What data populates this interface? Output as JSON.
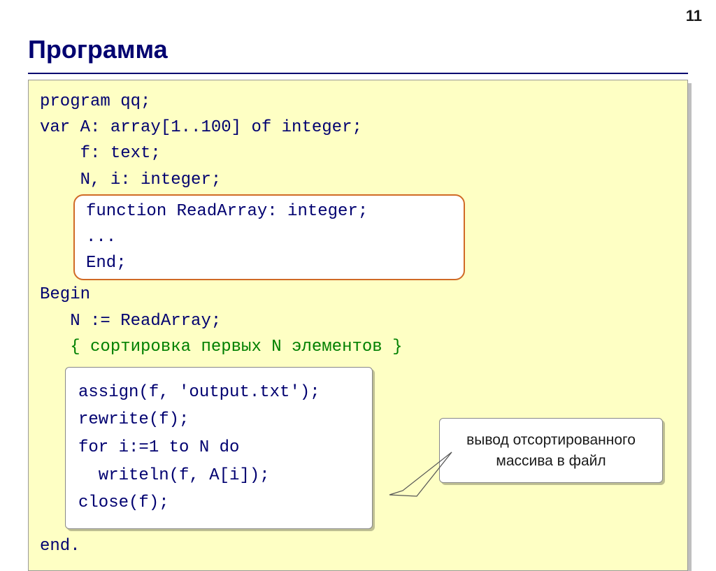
{
  "pageNumber": "11",
  "title": "Программа",
  "code": {
    "l1": "program qq;",
    "l2": "var A: array[1..100] of integer;",
    "l3": "    f: text;",
    "l4": "    N, i: integer;",
    "func": {
      "f1": "function ReadArray: integer;",
      "f2": "...",
      "f3": "End;"
    },
    "l5": "Begin",
    "l6": "   N := ReadArray;",
    "l7": "   { сортировка первых N элементов }",
    "out": {
      "o1": "assign(f, 'output.txt');",
      "o2": "rewrite(f);",
      "o3": "for i:=1 to N do",
      "o4": "  writeln(f, A[i]);",
      "o5": "close(f);"
    },
    "l8": "end."
  },
  "callout": "вывод отсортированного массива в файл"
}
